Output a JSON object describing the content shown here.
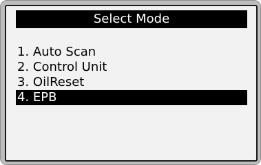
{
  "screen": {
    "title": "Select Mode",
    "menu": [
      {
        "label": "1. Auto Scan",
        "selected": false
      },
      {
        "label": "2. Control Unit",
        "selected": false
      },
      {
        "label": "3. OilReset",
        "selected": false
      },
      {
        "label": "4. EPB",
        "selected": true
      }
    ]
  },
  "colors": {
    "highlight_bg": "#000000",
    "highlight_text": "#ffffff",
    "screen_bg": "#f2f2f2"
  }
}
